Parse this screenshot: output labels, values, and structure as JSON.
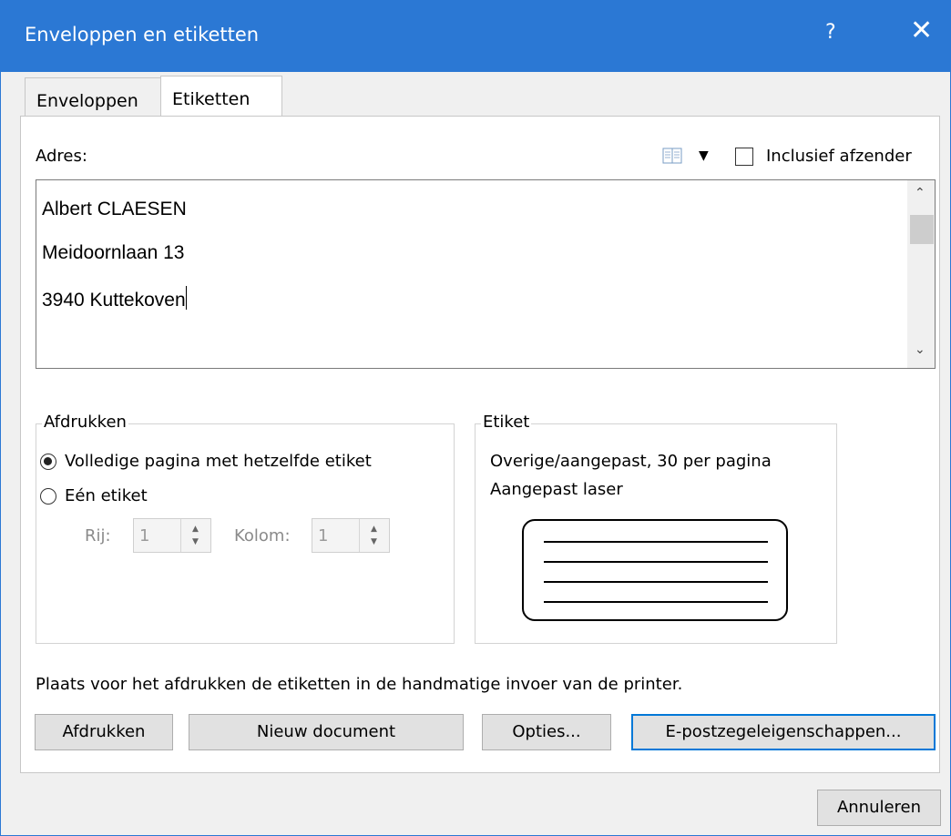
{
  "window": {
    "title": "Enveloppen en etiketten",
    "help": "?",
    "close": "✕"
  },
  "tabs": [
    {
      "label": "Enveloppen",
      "active": false
    },
    {
      "label": "Etiketten",
      "active": true
    }
  ],
  "address": {
    "label": "Adres:",
    "lines": [
      "Albert CLAESEN",
      "Meidoornlaan 13",
      "3940 Kuttekoven"
    ],
    "address_book_icon": "address-book-icon",
    "include_sender_label": "Inclusief afzender",
    "include_sender_checked": false
  },
  "print_group": {
    "title": "Afdrukken",
    "options": [
      {
        "label": "Volledige pagina met hetzelfde etiket",
        "selected": true
      },
      {
        "label": "Eén etiket",
        "selected": false
      }
    ],
    "row_label": "Rij:",
    "row_value": "1",
    "column_label": "Kolom:",
    "column_value": "1"
  },
  "label_group": {
    "title": "Etiket",
    "line1": "Overige/aangepast, 30 per pagina",
    "line2": "Aangepast laser"
  },
  "hint": "Plaats voor het afdrukken de etiketten in de handmatige invoer van de printer.",
  "buttons": {
    "print": "Afdrukken",
    "new_document": "Nieuw document",
    "options": "Opties...",
    "epostage": "E-postzegeleigenschappen...",
    "cancel": "Annuleren"
  },
  "colors": {
    "titlebar": "#2b78d4",
    "background": "#f0f0f0",
    "panel": "#ffffff"
  }
}
